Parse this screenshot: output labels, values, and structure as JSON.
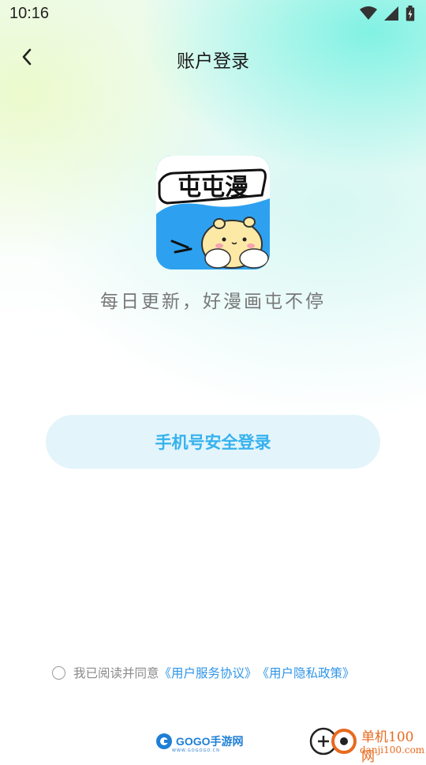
{
  "status_bar": {
    "time": "10:16",
    "icons": [
      "wifi-icon",
      "signal-icon",
      "battery-icon"
    ]
  },
  "nav": {
    "title": "账户登录",
    "back_icon": "chevron-left-icon"
  },
  "logo": {
    "text": "屯屯漫",
    "alt": "app-logo"
  },
  "slogan": "每日更新，好漫画屯不停",
  "login_button": {
    "label": "手机号安全登录"
  },
  "agreement": {
    "prefix": "我已阅读并同意",
    "terms_link": "《用户服务协议》",
    "privacy_link": "《用户隐私政策》",
    "checked": false
  },
  "watermarks": {
    "left_text": "GOGO手游网",
    "left_sub": "WWW.GOGOGO.CN",
    "right_cn": "单机100网",
    "right_en": "danji100.com"
  },
  "colors": {
    "accent": "#35b2ee",
    "button_bg": "#e3f4fb",
    "link": "#2f95e8",
    "logo_bg": "#2da1ef"
  }
}
